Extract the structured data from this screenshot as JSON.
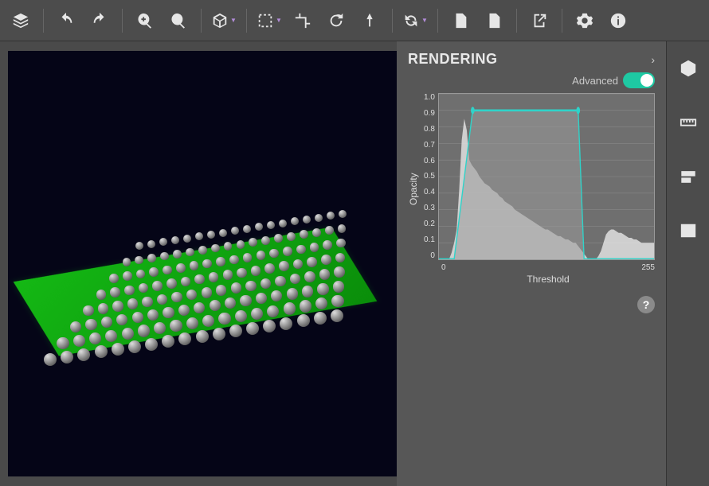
{
  "toolbar": {
    "layers": "layers-icon",
    "undo": "undo-icon",
    "redo": "redo-icon",
    "zoom_in": "zoom-in-icon",
    "zoom_out": "zoom-out-icon",
    "cube_menu": "cube-icon",
    "select_menu": "select-icon",
    "crop": "crop-icon",
    "rotate": "rotate-icon",
    "marker": "marker-icon",
    "sync_rotate": "sync-rotate-icon",
    "export_pdf": "pdf-icon",
    "export_csv": "csv-icon",
    "share": "share-icon",
    "settings": "settings-icon",
    "info": "info-icon"
  },
  "panel": {
    "title": "RENDERING",
    "advanced_label": "Advanced",
    "advanced_on": true
  },
  "rail": {
    "view3d": "3d-cube-icon",
    "ruler": "ruler-icon",
    "levels": "levels-icon",
    "image": "image-icon"
  },
  "chart_data": {
    "type": "area",
    "title": "",
    "xlabel": "Threshold",
    "ylabel": "Opacity",
    "xlim": [
      0,
      255
    ],
    "ylim": [
      0,
      1.0
    ],
    "y_ticks": [
      "1.0",
      "0.9",
      "0.8",
      "0.7",
      "0.6",
      "0.5",
      "0.4",
      "0.3",
      "0.2",
      "0.1",
      "0"
    ],
    "x_ticks": [
      "0",
      "255"
    ],
    "transfer_function": {
      "points": [
        {
          "x": 0,
          "y": 0.0
        },
        {
          "x": 18,
          "y": 0.0
        },
        {
          "x": 40,
          "y": 0.9
        },
        {
          "x": 165,
          "y": 0.9
        },
        {
          "x": 172,
          "y": 0.0
        },
        {
          "x": 255,
          "y": 0.0
        }
      ],
      "handles": [
        {
          "x": 40,
          "y": 0.9
        },
        {
          "x": 165,
          "y": 0.9
        }
      ],
      "stroke": "#2fd3c9"
    },
    "histogram": [
      {
        "x": 0,
        "y": 0.0
      },
      {
        "x": 3,
        "y": 0.0
      },
      {
        "x": 6,
        "y": 0.0
      },
      {
        "x": 9,
        "y": 0.0
      },
      {
        "x": 12,
        "y": 0.0
      },
      {
        "x": 15,
        "y": 0.04
      },
      {
        "x": 18,
        "y": 0.1
      },
      {
        "x": 21,
        "y": 0.18
      },
      {
        "x": 24,
        "y": 0.42
      },
      {
        "x": 27,
        "y": 0.72
      },
      {
        "x": 30,
        "y": 0.85
      },
      {
        "x": 33,
        "y": 0.78
      },
      {
        "x": 36,
        "y": 0.6
      },
      {
        "x": 39,
        "y": 0.57
      },
      {
        "x": 42,
        "y": 0.55
      },
      {
        "x": 45,
        "y": 0.53
      },
      {
        "x": 48,
        "y": 0.5
      },
      {
        "x": 51,
        "y": 0.48
      },
      {
        "x": 54,
        "y": 0.46
      },
      {
        "x": 57,
        "y": 0.45
      },
      {
        "x": 60,
        "y": 0.44
      },
      {
        "x": 63,
        "y": 0.42
      },
      {
        "x": 66,
        "y": 0.41
      },
      {
        "x": 69,
        "y": 0.4
      },
      {
        "x": 72,
        "y": 0.38
      },
      {
        "x": 75,
        "y": 0.37
      },
      {
        "x": 78,
        "y": 0.35
      },
      {
        "x": 81,
        "y": 0.34
      },
      {
        "x": 84,
        "y": 0.33
      },
      {
        "x": 87,
        "y": 0.32
      },
      {
        "x": 90,
        "y": 0.3
      },
      {
        "x": 93,
        "y": 0.29
      },
      {
        "x": 96,
        "y": 0.28
      },
      {
        "x": 99,
        "y": 0.27
      },
      {
        "x": 102,
        "y": 0.26
      },
      {
        "x": 105,
        "y": 0.25
      },
      {
        "x": 108,
        "y": 0.24
      },
      {
        "x": 111,
        "y": 0.23
      },
      {
        "x": 114,
        "y": 0.22
      },
      {
        "x": 117,
        "y": 0.21
      },
      {
        "x": 120,
        "y": 0.2
      },
      {
        "x": 123,
        "y": 0.19
      },
      {
        "x": 126,
        "y": 0.18
      },
      {
        "x": 129,
        "y": 0.18
      },
      {
        "x": 132,
        "y": 0.17
      },
      {
        "x": 135,
        "y": 0.16
      },
      {
        "x": 138,
        "y": 0.15
      },
      {
        "x": 141,
        "y": 0.14
      },
      {
        "x": 144,
        "y": 0.14
      },
      {
        "x": 147,
        "y": 0.13
      },
      {
        "x": 150,
        "y": 0.12
      },
      {
        "x": 153,
        "y": 0.12
      },
      {
        "x": 156,
        "y": 0.11
      },
      {
        "x": 159,
        "y": 0.1
      },
      {
        "x": 162,
        "y": 0.1
      },
      {
        "x": 165,
        "y": 0.08
      },
      {
        "x": 168,
        "y": 0.06
      },
      {
        "x": 171,
        "y": 0.04
      },
      {
        "x": 174,
        "y": 0.02
      },
      {
        "x": 177,
        "y": 0.0
      },
      {
        "x": 180,
        "y": 0.0
      },
      {
        "x": 183,
        "y": 0.0
      },
      {
        "x": 186,
        "y": 0.0
      },
      {
        "x": 189,
        "y": 0.02
      },
      {
        "x": 192,
        "y": 0.05
      },
      {
        "x": 195,
        "y": 0.1
      },
      {
        "x": 198,
        "y": 0.15
      },
      {
        "x": 201,
        "y": 0.17
      },
      {
        "x": 204,
        "y": 0.18
      },
      {
        "x": 207,
        "y": 0.18
      },
      {
        "x": 210,
        "y": 0.17
      },
      {
        "x": 213,
        "y": 0.16
      },
      {
        "x": 216,
        "y": 0.16
      },
      {
        "x": 219,
        "y": 0.15
      },
      {
        "x": 222,
        "y": 0.14
      },
      {
        "x": 225,
        "y": 0.13
      },
      {
        "x": 228,
        "y": 0.13
      },
      {
        "x": 231,
        "y": 0.12
      },
      {
        "x": 234,
        "y": 0.12
      },
      {
        "x": 237,
        "y": 0.11
      },
      {
        "x": 240,
        "y": 0.1
      },
      {
        "x": 243,
        "y": 0.1
      },
      {
        "x": 246,
        "y": 0.1
      },
      {
        "x": 249,
        "y": 0.1
      },
      {
        "x": 252,
        "y": 0.1
      },
      {
        "x": 255,
        "y": 0.1
      }
    ]
  }
}
